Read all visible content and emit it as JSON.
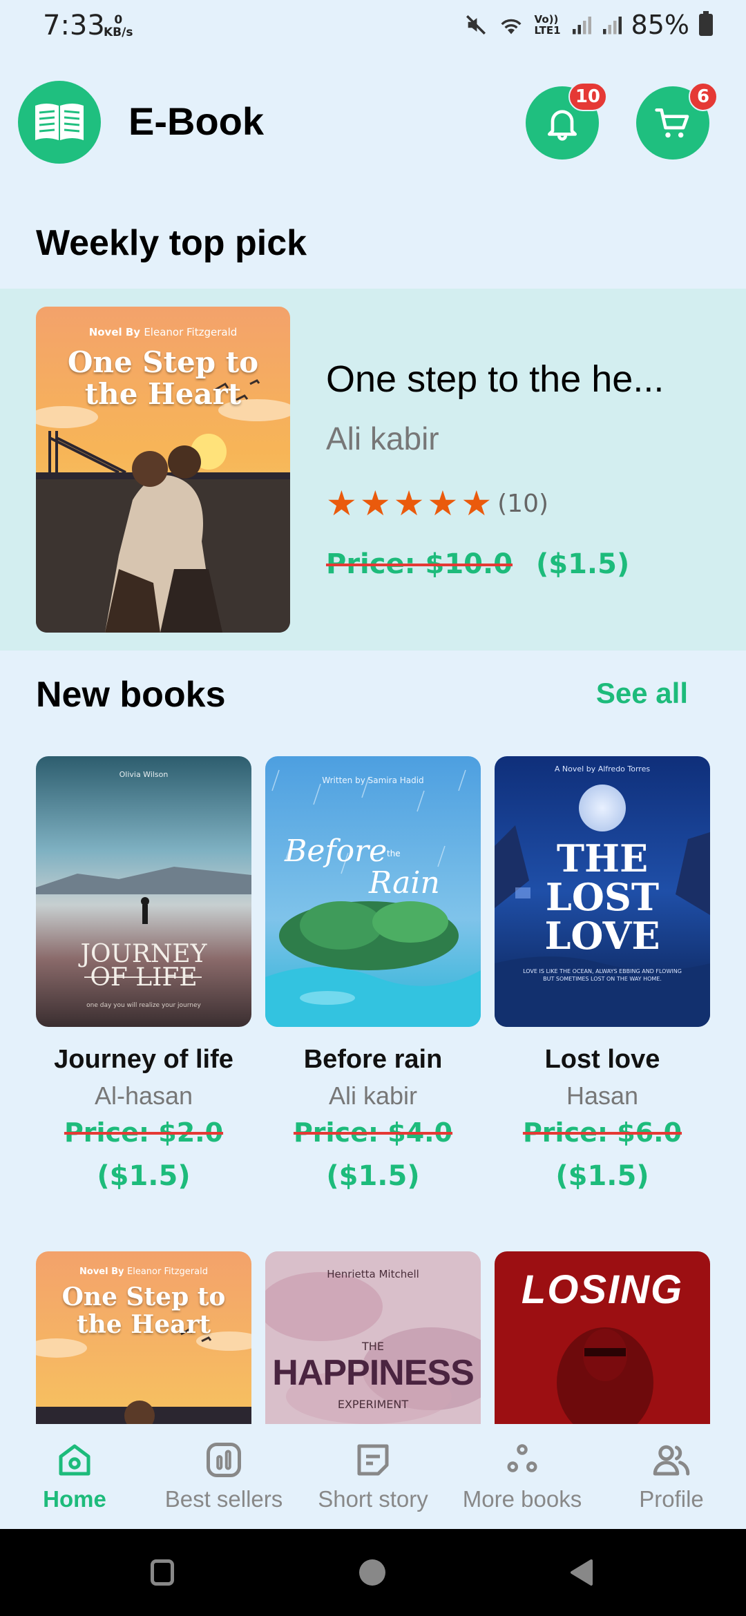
{
  "status_bar": {
    "time": "7:33",
    "net_speed_value": "0",
    "net_speed_unit": "KB/s",
    "lte_top": "Vo))",
    "lte_bottom": "LTE1",
    "battery": "85%"
  },
  "header": {
    "title": "E-Book",
    "notifications_count": "10",
    "cart_count": "6"
  },
  "weekly": {
    "section_title": "Weekly top pick",
    "book": {
      "title": "One step to the he...",
      "author": "Ali kabir",
      "rating": 5,
      "rating_count": "(10)",
      "old_price": "Price: $10.0",
      "new_price": "($1.5)",
      "cover": {
        "byline_prefix": "Novel By",
        "byline_name": "Eleanor Fitzgerald",
        "title_line1": "One Step to",
        "title_line2": "the Heart"
      }
    }
  },
  "new_books": {
    "section_title": "New books",
    "see_all": "See all",
    "items": [
      {
        "title": "Journey of life",
        "author": "Al-hasan",
        "old_price": "Price: $2.0",
        "new_price": "($1.5)",
        "cover_top": "Olivia Wilson",
        "cover_title1": "JOURNEY",
        "cover_title2": "OF LIFE",
        "cover_bottom": "one day you will realize your journey"
      },
      {
        "title": "Before rain",
        "author": "Ali kabir",
        "old_price": "Price: $4.0",
        "new_price": "($1.5)",
        "cover_top": "Written by Samira Hadid",
        "cover_title1": "Before",
        "cover_title_the": "the",
        "cover_title2": "Rain"
      },
      {
        "title": "Lost love",
        "author": "Hasan",
        "old_price": "Price: $6.0",
        "new_price": "($1.5)",
        "cover_top": "A Novel by Alfredo Torres",
        "cover_title1": "THE",
        "cover_title2": "LOST",
        "cover_title3": "LOVE",
        "cover_bottom1": "LOVE IS LIKE THE OCEAN, ALWAYS EBBING AND FLOWING",
        "cover_bottom2": "BUT SOMETIMES LOST ON THE WAY HOME."
      }
    ],
    "row2": [
      {
        "cover_byline_prefix": "Novel By",
        "cover_byline_name": "Eleanor Fitzgerald",
        "cover_title1": "One Step to",
        "cover_title2": "the Heart"
      },
      {
        "cover_top": "Henrietta Mitchell",
        "cover_the": "THE",
        "cover_title": "HAPPINESS",
        "cover_sub": "EXPERIMENT"
      },
      {
        "cover_title": "LOSING"
      }
    ]
  },
  "bottom_nav": [
    {
      "label": "Home",
      "icon": "home-icon",
      "active": true
    },
    {
      "label": "Best sellers",
      "icon": "chart-icon",
      "active": false
    },
    {
      "label": "Short story",
      "icon": "note-icon",
      "active": false
    },
    {
      "label": "More books",
      "icon": "dots-icon",
      "active": false
    },
    {
      "label": "Profile",
      "icon": "users-icon",
      "active": false
    }
  ],
  "colors": {
    "background": "#e4f1fb",
    "accent": "#1fbf7f",
    "featured_bg": "#d3eef0",
    "star": "#ea5a0c",
    "badge": "#e53935"
  }
}
